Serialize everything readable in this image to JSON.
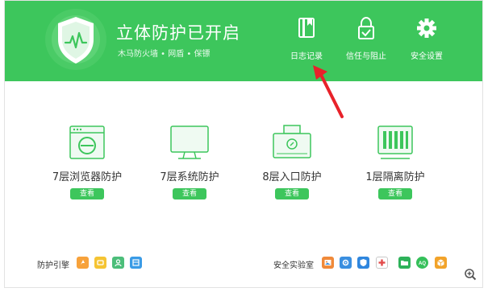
{
  "header": {
    "title": "立体防护已开启",
    "subtitle": "木马防火墙 • 网盾 • 保镖",
    "bg_color": "#3dc65c",
    "buttons": [
      {
        "label": "日志记录",
        "icon": "log-book-icon"
      },
      {
        "label": "信任与阻止",
        "icon": "lock-check-icon"
      },
      {
        "label": "安全设置",
        "icon": "gear-icon"
      }
    ]
  },
  "modules": [
    {
      "label": "7层浏览器防护",
      "button": "查看",
      "icon": "browser-window-icon"
    },
    {
      "label": "7层系统防护",
      "button": "查看",
      "icon": "monitor-icon"
    },
    {
      "label": "8层入口防护",
      "button": "查看",
      "icon": "entry-box-icon"
    },
    {
      "label": "1层隔离防护",
      "button": "查看",
      "icon": "isolation-bars-icon"
    }
  ],
  "footer": {
    "engine_label": "防护引擎",
    "engine_icons": [
      {
        "name": "engine-orange-icon",
        "color": "#f7a23b"
      },
      {
        "name": "engine-yellow-icon",
        "color": "#f5c433"
      },
      {
        "name": "engine-green-icon",
        "color": "#4cbe7a"
      },
      {
        "name": "engine-blue-icon",
        "color": "#3a9be6"
      }
    ],
    "lab_label": "安全实验室",
    "lab_icons": [
      {
        "name": "lab-image-icon",
        "color": "#f08a3a"
      },
      {
        "name": "lab-gear-icon",
        "color": "#3a8fe0"
      },
      {
        "name": "lab-shield-icon",
        "color": "#2f86de"
      },
      {
        "name": "lab-firstaid-icon",
        "color": "#e24a4a"
      },
      {
        "name": "lab-folder-icon",
        "color": "#2eb25a"
      },
      {
        "name": "lab-aq-icon",
        "color": "#35c05a"
      },
      {
        "name": "lab-box-icon",
        "color": "#f2a32a"
      }
    ]
  }
}
